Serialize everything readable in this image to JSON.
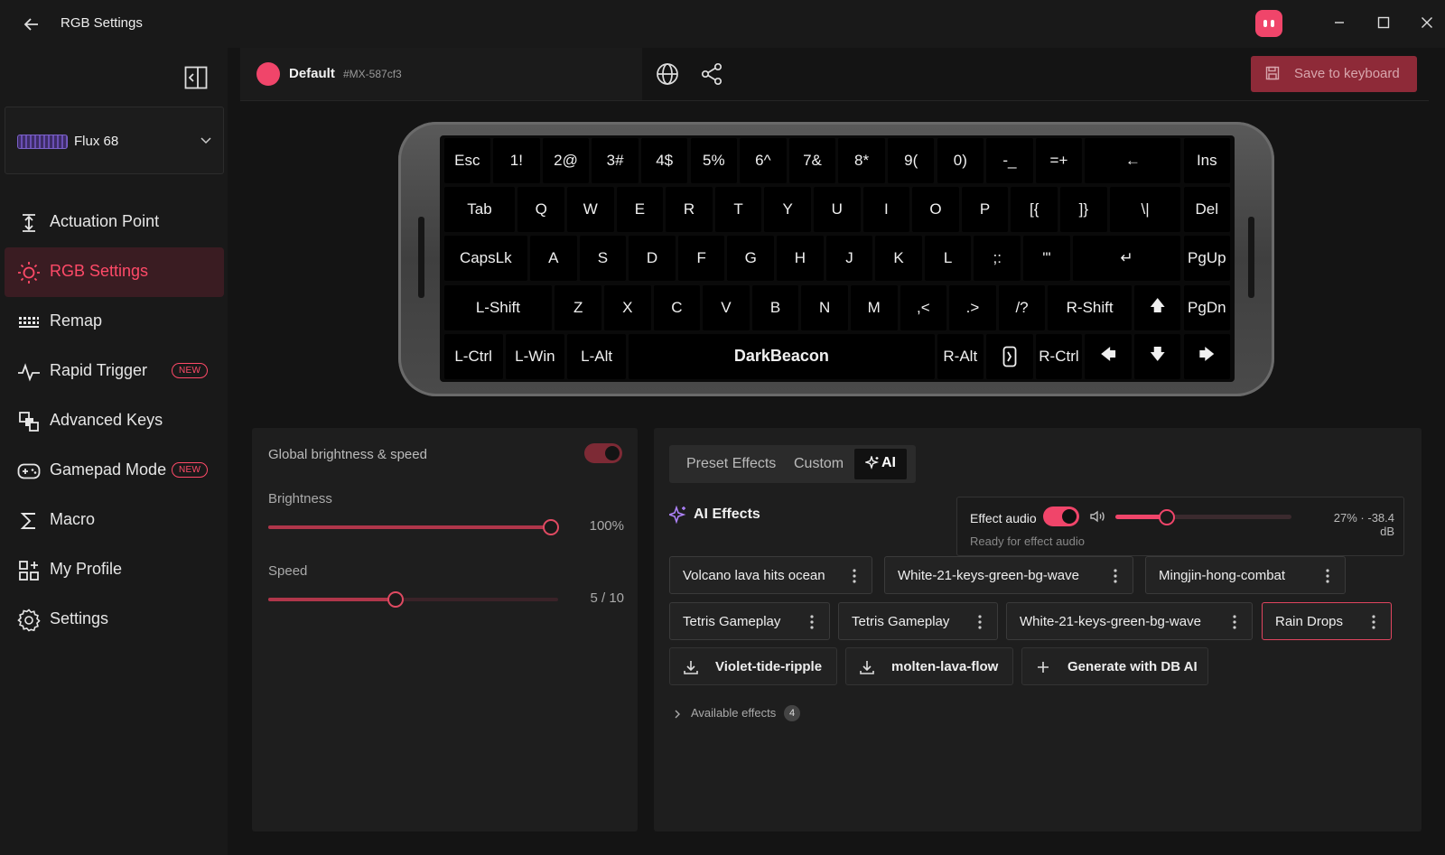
{
  "window": {
    "title": "RGB Settings",
    "accent": "#f0456a"
  },
  "sidebar": {
    "device": {
      "name": "Flux 68"
    },
    "items": [
      {
        "label": "Actuation Point",
        "icon": "actuation-icon",
        "active": false,
        "badge": ""
      },
      {
        "label": "RGB Settings",
        "icon": "sun-icon",
        "active": true,
        "badge": ""
      },
      {
        "label": "Remap",
        "icon": "keyboard-icon",
        "active": false,
        "badge": ""
      },
      {
        "label": "Rapid Trigger",
        "icon": "pulse-icon",
        "active": false,
        "badge": "NEW"
      },
      {
        "label": "Advanced Keys",
        "icon": "advanced-keys-icon",
        "active": false,
        "badge": ""
      },
      {
        "label": "Gamepad Mode",
        "icon": "gamepad-icon",
        "active": false,
        "badge": "NEW"
      },
      {
        "label": "Macro",
        "icon": "sigma-icon",
        "active": false,
        "badge": ""
      },
      {
        "label": "My Profile",
        "icon": "profile-grid-icon",
        "active": false,
        "badge": ""
      },
      {
        "label": "Settings",
        "icon": "gear-icon",
        "active": false,
        "badge": ""
      }
    ]
  },
  "profile": {
    "name": "Default",
    "id": "#MX-587cf3",
    "color": "#f0456a",
    "save_label": "Save to keyboard"
  },
  "keyboard": {
    "rows": [
      [
        "Esc",
        "1!",
        "2@",
        "3#",
        "4$",
        "5%",
        "6^",
        "7&",
        "8*",
        "9(",
        "0)",
        "-_",
        "=+",
        "←",
        "Ins"
      ],
      [
        "Tab",
        "Q",
        "W",
        "E",
        "R",
        "T",
        "Y",
        "U",
        "I",
        "O",
        "P",
        "[{",
        "]}",
        "\\|",
        "Del"
      ],
      [
        "CapsLk",
        "A",
        "S",
        "D",
        "F",
        "G",
        "H",
        "J",
        "K",
        "L",
        ";:",
        "'\"",
        "↵",
        "PgUp"
      ],
      [
        "L-Shift",
        "Z",
        "X",
        "C",
        "V",
        "B",
        "N",
        "M",
        ",<",
        ".>",
        "/?",
        "R-Shift",
        "🡅",
        "PgDn"
      ],
      [
        "L-Ctrl",
        "L-Win",
        "L-Alt",
        "DarkBeacon",
        "R-Alt",
        "",
        "R-Ctrl",
        "🡄",
        "🡇",
        "🡆"
      ]
    ]
  },
  "global": {
    "title": "Global brightness & speed",
    "enabled": true,
    "brightness_label": "Brightness",
    "brightness_value": "100%",
    "brightness_fraction": 1.0,
    "speed_label": "Speed",
    "speed_value": "5 / 10",
    "speed_fraction": 0.45
  },
  "effects": {
    "tabs": [
      "Preset Effects",
      "Custom",
      "AI"
    ],
    "active_tab": "AI",
    "heading": "AI Effects",
    "audio": {
      "label": "Effect audio",
      "enabled": true,
      "level_text": "27% · -38.4 dB",
      "level_fraction": 0.29,
      "status": "Ready for effect audio"
    },
    "items": [
      {
        "label": "Volcano lava hits ocean",
        "selected": false
      },
      {
        "label": "White-21-keys-green-bg-wave",
        "selected": false
      },
      {
        "label": "Mingjin-hong-combat",
        "selected": false
      },
      {
        "label": "Tetris Gameplay",
        "selected": false
      },
      {
        "label": "Tetris Gameplay",
        "selected": false
      },
      {
        "label": "White-21-keys-green-bg-wave",
        "selected": false
      },
      {
        "label": "Rain Drops",
        "selected": true
      }
    ],
    "actions": [
      {
        "label": "Violet-tide-ripple",
        "icon": "download-icon"
      },
      {
        "label": "molten-lava-flow",
        "icon": "download-icon"
      },
      {
        "label": "Generate with DB AI",
        "icon": "plus-icon"
      }
    ],
    "available_label": "Available effects",
    "available_count": "4"
  }
}
